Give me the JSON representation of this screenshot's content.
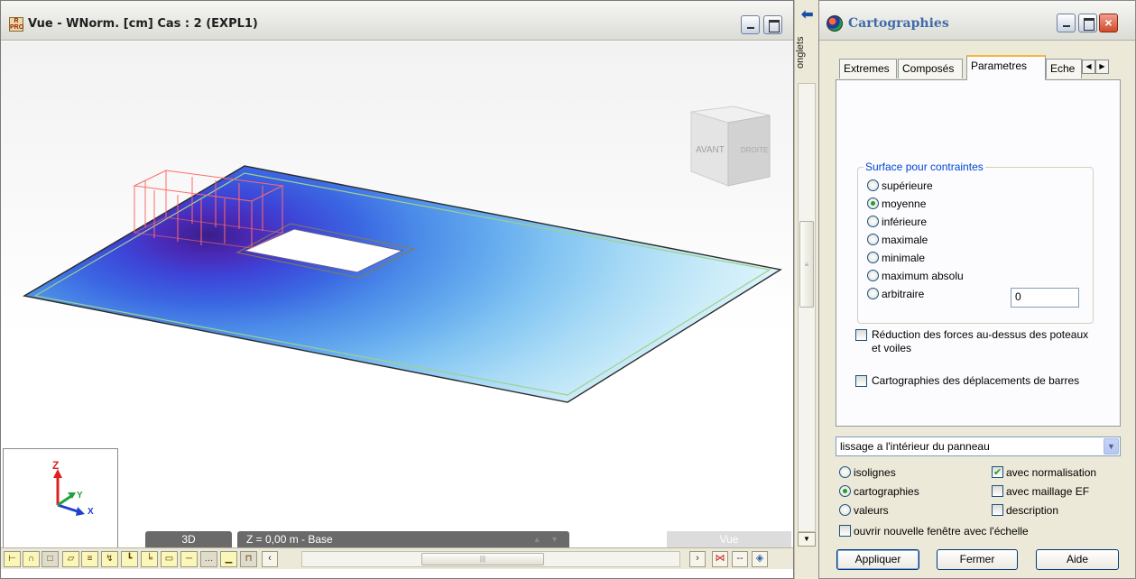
{
  "view_window": {
    "title": "Vue - WNorm. [cm] Cas : 2 (EXPL1)",
    "app_icon_text": "R\nPRO",
    "view_cube_front": "AVANT",
    "view_cube_right": "DROITE",
    "axes": {
      "z": "Z",
      "y": "Y",
      "x": "X"
    },
    "status_3d": "3D",
    "status_z": "Z = 0,00 m - Base",
    "status_vue": "Vue"
  },
  "onglets": {
    "label": "onglets"
  },
  "carto_window": {
    "title": "Cartographies",
    "tabs": [
      {
        "label": "Extremes"
      },
      {
        "label": "Composés"
      },
      {
        "label": "Parametres"
      },
      {
        "label": "Eche"
      }
    ],
    "surface_group": {
      "title": "Surface pour contraintes",
      "options": [
        {
          "label": "supérieure",
          "selected": false
        },
        {
          "label": "moyenne",
          "selected": true
        },
        {
          "label": "inférieure",
          "selected": false
        },
        {
          "label": "maximale",
          "selected": false
        },
        {
          "label": "minimale",
          "selected": false
        },
        {
          "label": "maximum absolu",
          "selected": false
        },
        {
          "label": "arbitraire",
          "selected": false
        }
      ],
      "arbitrary_value": "0"
    },
    "reduction_check": {
      "label": "Réduction des forces au-dessus des poteaux et voiles",
      "checked": false
    },
    "bar_disp_check": {
      "label": "Cartographies des déplacements de barres",
      "checked": false
    },
    "smoothing_select": "lissage a l'intérieur du panneau",
    "display_modes": [
      {
        "label": "isolignes",
        "selected": false
      },
      {
        "label": "cartographies",
        "selected": true
      },
      {
        "label": "valeurs",
        "selected": false
      }
    ],
    "flags": [
      {
        "label": "avec normalisation",
        "checked": true
      },
      {
        "label": "avec maillage EF",
        "checked": false
      },
      {
        "label": "description",
        "checked": false
      }
    ],
    "new_window_check": {
      "label": "ouvrir nouvelle fenêtre avec l'échelle",
      "checked": false
    },
    "buttons": {
      "apply": "Appliquer",
      "close": "Fermer",
      "help": "Aide"
    }
  },
  "colors": {
    "accent": "#0046d5",
    "plate_dark": "#3a2aa0",
    "plate_light": "#d9f2fb",
    "load": "#ff6060"
  }
}
